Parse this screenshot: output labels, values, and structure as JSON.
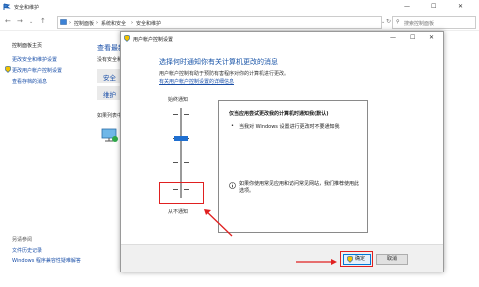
{
  "window": {
    "title": "安全和维护",
    "minimize": "—",
    "maximize": "☐",
    "close": "✕"
  },
  "address": {
    "crumbs": [
      "控制面板",
      "系统和安全",
      "安全和维护"
    ],
    "search_placeholder": "搜索控制面板"
  },
  "sidebar": {
    "links": [
      "控制面板主页",
      "更改安全和维护设置",
      "更改用户帐户控制设置",
      "查看存档的消息"
    ],
    "see_also_heading": "另请参阅",
    "see_also": [
      "文件历史记录",
      "Windows 程序兼容性疑难解答"
    ]
  },
  "main": {
    "heading": "查看最新",
    "subtitle": "没有安全和",
    "fragment1": "安全",
    "fragment2": "维护",
    "fragment3": "如果列表中"
  },
  "dialog": {
    "title": "用户帐户控制设置",
    "heading": "选择何时通知你有关计算机更改的消息",
    "desc": "用户帐户控制有助于预防有害程序对你的计算机进行更改。",
    "link": "有关用户帐户控制设置的详细信息",
    "slider_top": "始终通知",
    "slider_bottom": "从不通知",
    "slider_level": 0,
    "panel_title": "仅当应用尝试更改我的计算机时通知我(默认)",
    "panel_bullet": "当我对 Windows 设置进行更改时不要通知我",
    "panel_note": "如果你使用常见应用和访问常见网站，我们推荐使用此选项。",
    "ok": "确定",
    "cancel": "取消"
  },
  "colors": {
    "link": "#1a4fa8",
    "dialog_heading": "#1a55a8",
    "annotation": "#e02020"
  }
}
